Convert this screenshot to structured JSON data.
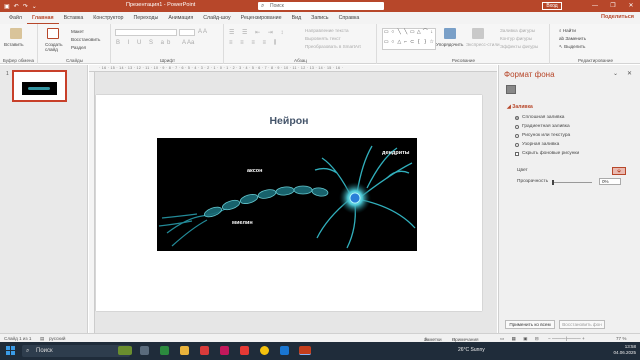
{
  "titlebar": {
    "document": "Презентация1 - PowerPoint",
    "search_placeholder": "Поиск",
    "signin": "Вход",
    "minimize": "—",
    "restore": "❐",
    "close": "✕"
  },
  "tabs": [
    "Файл",
    "Главная",
    "Вставка",
    "Конструктор",
    "Переходы",
    "Анимация",
    "Слайд-шоу",
    "Рецензирование",
    "Вид",
    "Запись",
    "Справка"
  ],
  "active_tab": "Главная",
  "share": "Поделиться",
  "ribbon": {
    "clipboard": {
      "paste": "Вставить",
      "label": "Буфер обмена"
    },
    "slides": {
      "new_slide": "Создать слайд",
      "layout": "Макет",
      "reset": "Восстановить",
      "section": "Раздел",
      "label": "Слайды"
    },
    "font": {
      "label": "Шрифт"
    },
    "paragraph": {
      "text_direction": "Направление текста",
      "align_text": "Выровнять текст",
      "smartart": "Преобразовать в SmartArt",
      "label": "Абзац"
    },
    "drawing": {
      "arrange": "Упорядочить",
      "quick_styles": "Экспресс-стили",
      "fill": "Заливка фигуры",
      "outline": "Контур фигуры",
      "effects": "Эффекты фигуры",
      "label": "Рисование"
    },
    "editing": {
      "find": "Найти",
      "replace": "Заменить",
      "select": "Выделить",
      "label": "Редактирование"
    }
  },
  "thumbnails": [
    {
      "number": "1"
    }
  ],
  "ruler_text": "· 16 · 15 · 14 · 13 · 12 · 11 · 10 · 9 · 8 · 7 · 6 · 5 · 4 · 3 · 2 · 1 · 0 · 1 · 2 · 3 · 4 · 5 · 6 · 7 · 8 · 9 · 10 · 11 · 12 · 13 · 14 · 15 · 16 ·",
  "slide": {
    "title": "Нейрон",
    "labels": {
      "axon": "аксон",
      "dendrites": "дендриты",
      "myelin": "миелин"
    }
  },
  "pane": {
    "title": "Формат фона",
    "section": "Заливка",
    "options": [
      {
        "label": "Сплошная заливка",
        "selected": true
      },
      {
        "label": "Градиентная заливка",
        "selected": false
      },
      {
        "label": "Рисунок или текстура",
        "selected": false
      },
      {
        "label": "Узорная заливка",
        "selected": false
      }
    ],
    "hide_graphics": "Скрыть фоновые рисунки",
    "color_label": "Цвет",
    "transparency_label": "Прозрачность",
    "transparency_value": "0%",
    "transparency_level": 0,
    "apply_all": "Применить ко всем",
    "reset_bg": "Восстановить фон"
  },
  "status": {
    "slide": "Слайд 1 из 1",
    "language": "русский",
    "notes": "Заметки",
    "comments": "Примечания",
    "zoom": "77 %"
  },
  "taskbar": {
    "search": "Поиск",
    "weather": "26°C  Sunny",
    "time": "13:58",
    "date": "04.06.2025"
  },
  "colors": {
    "accent": "#b7472a",
    "taskbar": "#1f2c3a",
    "axon_glow": "#3fb8c8"
  }
}
